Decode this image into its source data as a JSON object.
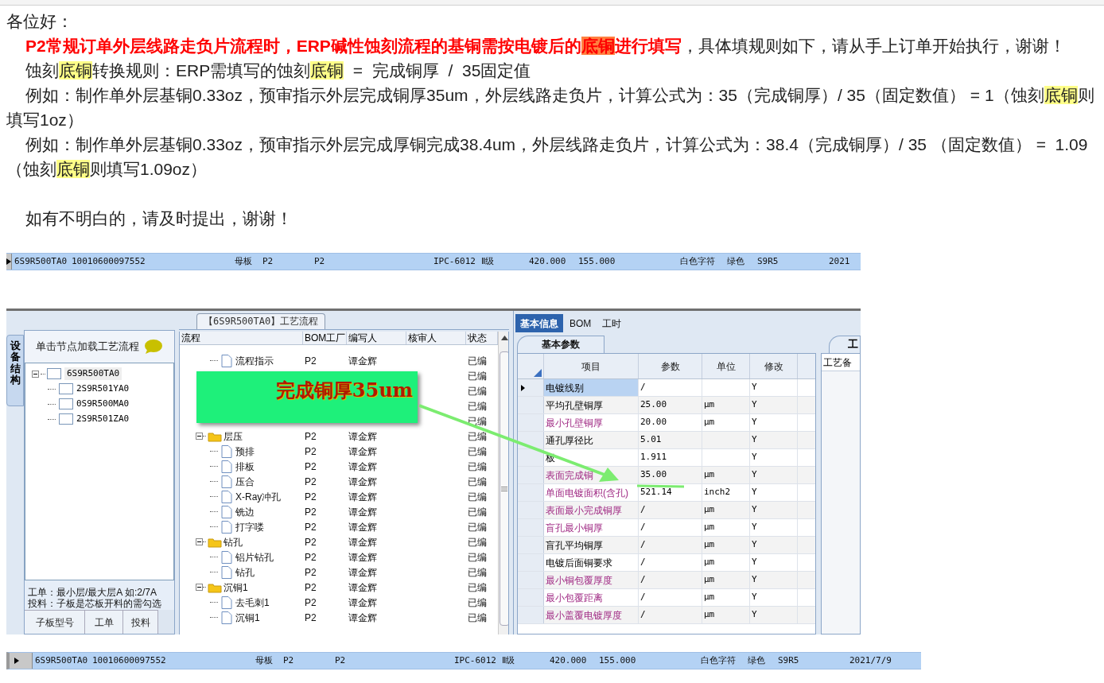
{
  "letter": {
    "paragraphs": [
      {
        "kind": "greeting",
        "segments": [
          {
            "kind": "plain",
            "text": "各位好："
          }
        ]
      },
      {
        "kind": "body",
        "segments": [
          {
            "kind": "alert",
            "text": "P2常规订单外层线路走负片流程时，ERP碱性蚀刻流程的基铜需按电镀后的"
          },
          {
            "kind": "alert_mark",
            "text": "底铜"
          },
          {
            "kind": "alert",
            "text": "进行填写"
          },
          {
            "kind": "plain",
            "text": "，具体填规则如下，请从手上订单开始执行，谢谢！"
          }
        ]
      },
      {
        "kind": "body",
        "segments": [
          {
            "kind": "plain",
            "text": "蚀刻"
          },
          {
            "kind": "mark",
            "text": "底铜"
          },
          {
            "kind": "plain",
            "text": "转换规则：ERP需填写的蚀刻"
          },
          {
            "kind": "mark",
            "text": "底铜"
          },
          {
            "kind": "plain",
            "text": "  =  完成铜厚  /  35固定值"
          }
        ]
      },
      {
        "kind": "body",
        "segments": [
          {
            "kind": "plain",
            "text": "例如：制作单外层基铜0.33oz，预审指示外层完成铜厚35um，外层线路走负片，计算公式为：35（完成铜厚）/ 35（固定数值） = 1（蚀刻"
          },
          {
            "kind": "mark",
            "text": "底铜"
          },
          {
            "kind": "plain",
            "text": "则填写1oz）"
          }
        ]
      },
      {
        "kind": "body",
        "segments": [
          {
            "kind": "plain",
            "text": "例如：制作单外层基铜0.33oz，预审指示外层完成厚铜完成38.4um，外层线路走负片，计算公式为：38.4（完成铜厚）/ 35 （固定数值） =  1.09 （蚀刻"
          },
          {
            "kind": "mark",
            "text": "底铜"
          },
          {
            "kind": "plain",
            "text": "则填写1.09oz）"
          }
        ]
      },
      {
        "kind": "closing",
        "segments": [
          {
            "kind": "plain",
            "text": "如有不明白的，请及时提出，谢谢！"
          }
        ]
      }
    ]
  },
  "records": [
    {
      "cells": [
        "6S9R500TA0",
        "10010600097552",
        "母板",
        "P2",
        "P2",
        "IPC-6012 Ⅱ级",
        "420.000",
        "155.000",
        "白色字符",
        "绿色",
        "S9R5",
        "2021"
      ]
    },
    {
      "cells": [
        "6S9R500TA0",
        "10010600097552",
        "母板",
        "P2",
        "P2",
        "IPC-6012 Ⅱ级",
        "420.000",
        "155.000",
        "白色字符",
        "绿色",
        "S9R5",
        "2021/7/9"
      ]
    }
  ],
  "app": {
    "left": {
      "side_tab": "设备结构",
      "hint": "单击节点加载工艺流程",
      "tree": {
        "name": "6S9R500TA0",
        "expanded": true,
        "children": [
          {
            "name": "2S9R501YA0"
          },
          {
            "name": "0S9R500MA0"
          },
          {
            "name": "2S9R501ZA0"
          }
        ]
      },
      "notes": [
        "工单：最小层/最大层A 如:2/7A",
        "投料：子板是芯板开料的需勾选"
      ],
      "tabs": [
        "子板型号",
        "工单",
        "投料"
      ]
    },
    "flow": {
      "title": "【6S9R500TA0】工艺流程",
      "columns": [
        "流程",
        "BOM工厂",
        "编写人",
        "核审人",
        "状态"
      ],
      "rows": [
        {
          "kind": "doc",
          "name": "流程指示",
          "bom": "P2",
          "writer": "谭金辉",
          "status": "已编"
        },
        {
          "kind": "covered",
          "status": "已编"
        },
        {
          "kind": "covered",
          "status": "已编"
        },
        {
          "kind": "covered",
          "status": "已编"
        },
        {
          "kind": "covered",
          "status": "已编"
        },
        {
          "kind": "folder",
          "name": "层压",
          "bom": "P2",
          "writer": "谭金辉",
          "status": "已编",
          "children": [
            {
              "kind": "doc",
              "name": "预排",
              "bom": "P2",
              "writer": "谭金辉",
              "status": "已编"
            },
            {
              "kind": "doc",
              "name": "排板",
              "bom": "P2",
              "writer": "谭金辉",
              "status": "已编"
            },
            {
              "kind": "doc",
              "name": "压合",
              "bom": "P2",
              "writer": "谭金辉",
              "status": "已编"
            },
            {
              "kind": "doc",
              "name": "X-Ray冲孔",
              "bom": "P2",
              "writer": "谭金辉",
              "status": "已编"
            },
            {
              "kind": "doc",
              "name": "铣边",
              "bom": "P2",
              "writer": "谭金辉",
              "status": "已编"
            },
            {
              "kind": "doc",
              "name": "打字喽",
              "bom": "P2",
              "writer": "谭金辉",
              "status": "已编"
            }
          ]
        },
        {
          "kind": "folder",
          "name": "钻孔",
          "bom": "P2",
          "writer": "谭金辉",
          "status": "已编",
          "children": [
            {
              "kind": "doc",
              "name": "铝片钻孔",
              "bom": "P2",
              "writer": "谭金辉",
              "status": "已编"
            },
            {
              "kind": "doc",
              "name": "钻孔",
              "bom": "P2",
              "writer": "谭金辉",
              "status": "已编"
            }
          ]
        },
        {
          "kind": "folder",
          "name": "沉铜1",
          "bom": "P2",
          "writer": "谭金辉",
          "status": "已编",
          "children": [
            {
              "kind": "doc",
              "name": "去毛刺1",
              "bom": "P2",
              "writer": "谭金辉",
              "status": "已编"
            },
            {
              "kind": "doc",
              "name": "沉铜1",
              "bom": "P2",
              "writer": "谭金辉",
              "status": "已编"
            }
          ]
        }
      ]
    },
    "callout": {
      "text": "完成铜厚35um"
    },
    "details": {
      "tabs": [
        {
          "label": "基本信息",
          "selected": true
        },
        {
          "label": "BOM",
          "selected": false
        },
        {
          "label": "工时",
          "selected": false
        }
      ],
      "subtab": "基本参数",
      "columns": [
        "项目",
        "参数",
        "单位",
        "修改"
      ],
      "rows": [
        {
          "item": "电镀线别",
          "value": "/",
          "unit": "",
          "modify": "Y",
          "kind": "normal",
          "selected": true
        },
        {
          "item": "平均孔壁铜厚",
          "value": "25.00",
          "unit": "μm",
          "modify": "Y",
          "kind": "normal",
          "selected": false
        },
        {
          "item": "最小孔壁铜厚",
          "value": "20.00",
          "unit": "μm",
          "modify": "Y",
          "kind": "required",
          "selected": false
        },
        {
          "item": "通孔厚径比",
          "value": "5.01",
          "unit": "",
          "modify": "Y",
          "kind": "normal",
          "selected": false
        },
        {
          "item": "板",
          "value": "1.911",
          "unit": "",
          "modify": "Y",
          "kind": "normal",
          "selected": false
        },
        {
          "item": "表面完成铜",
          "value": "35.00",
          "unit": "μm",
          "modify": "Y",
          "kind": "required",
          "selected": false
        },
        {
          "item": "单面电镀面积(含孔)",
          "value": "521.14",
          "unit": "inch2",
          "modify": "Y",
          "kind": "required",
          "selected": false
        },
        {
          "item": "表面最小完成铜厚",
          "value": "/",
          "unit": "μm",
          "modify": "Y",
          "kind": "required",
          "selected": false
        },
        {
          "item": "盲孔最小铜厚",
          "value": "/",
          "unit": "μm",
          "modify": "Y",
          "kind": "required",
          "selected": false
        },
        {
          "item": "盲孔平均铜厚",
          "value": "/",
          "unit": "μm",
          "modify": "Y",
          "kind": "normal",
          "selected": false
        },
        {
          "item": "电镀后面铜要求",
          "value": "/",
          "unit": "μm",
          "modify": "Y",
          "kind": "normal",
          "selected": false
        },
        {
          "item": "最小铜包覆厚度",
          "value": "/",
          "unit": "μm",
          "modify": "Y",
          "kind": "required",
          "selected": false
        },
        {
          "item": "最小包覆距离",
          "value": "/",
          "unit": "μm",
          "modify": "Y",
          "kind": "required",
          "selected": false
        },
        {
          "item": "最小盖覆电镀厚度",
          "value": "/",
          "unit": "μm",
          "modify": "Y",
          "kind": "required",
          "selected": false
        }
      ]
    },
    "side": {
      "tab": "工",
      "label": "工艺备"
    }
  }
}
